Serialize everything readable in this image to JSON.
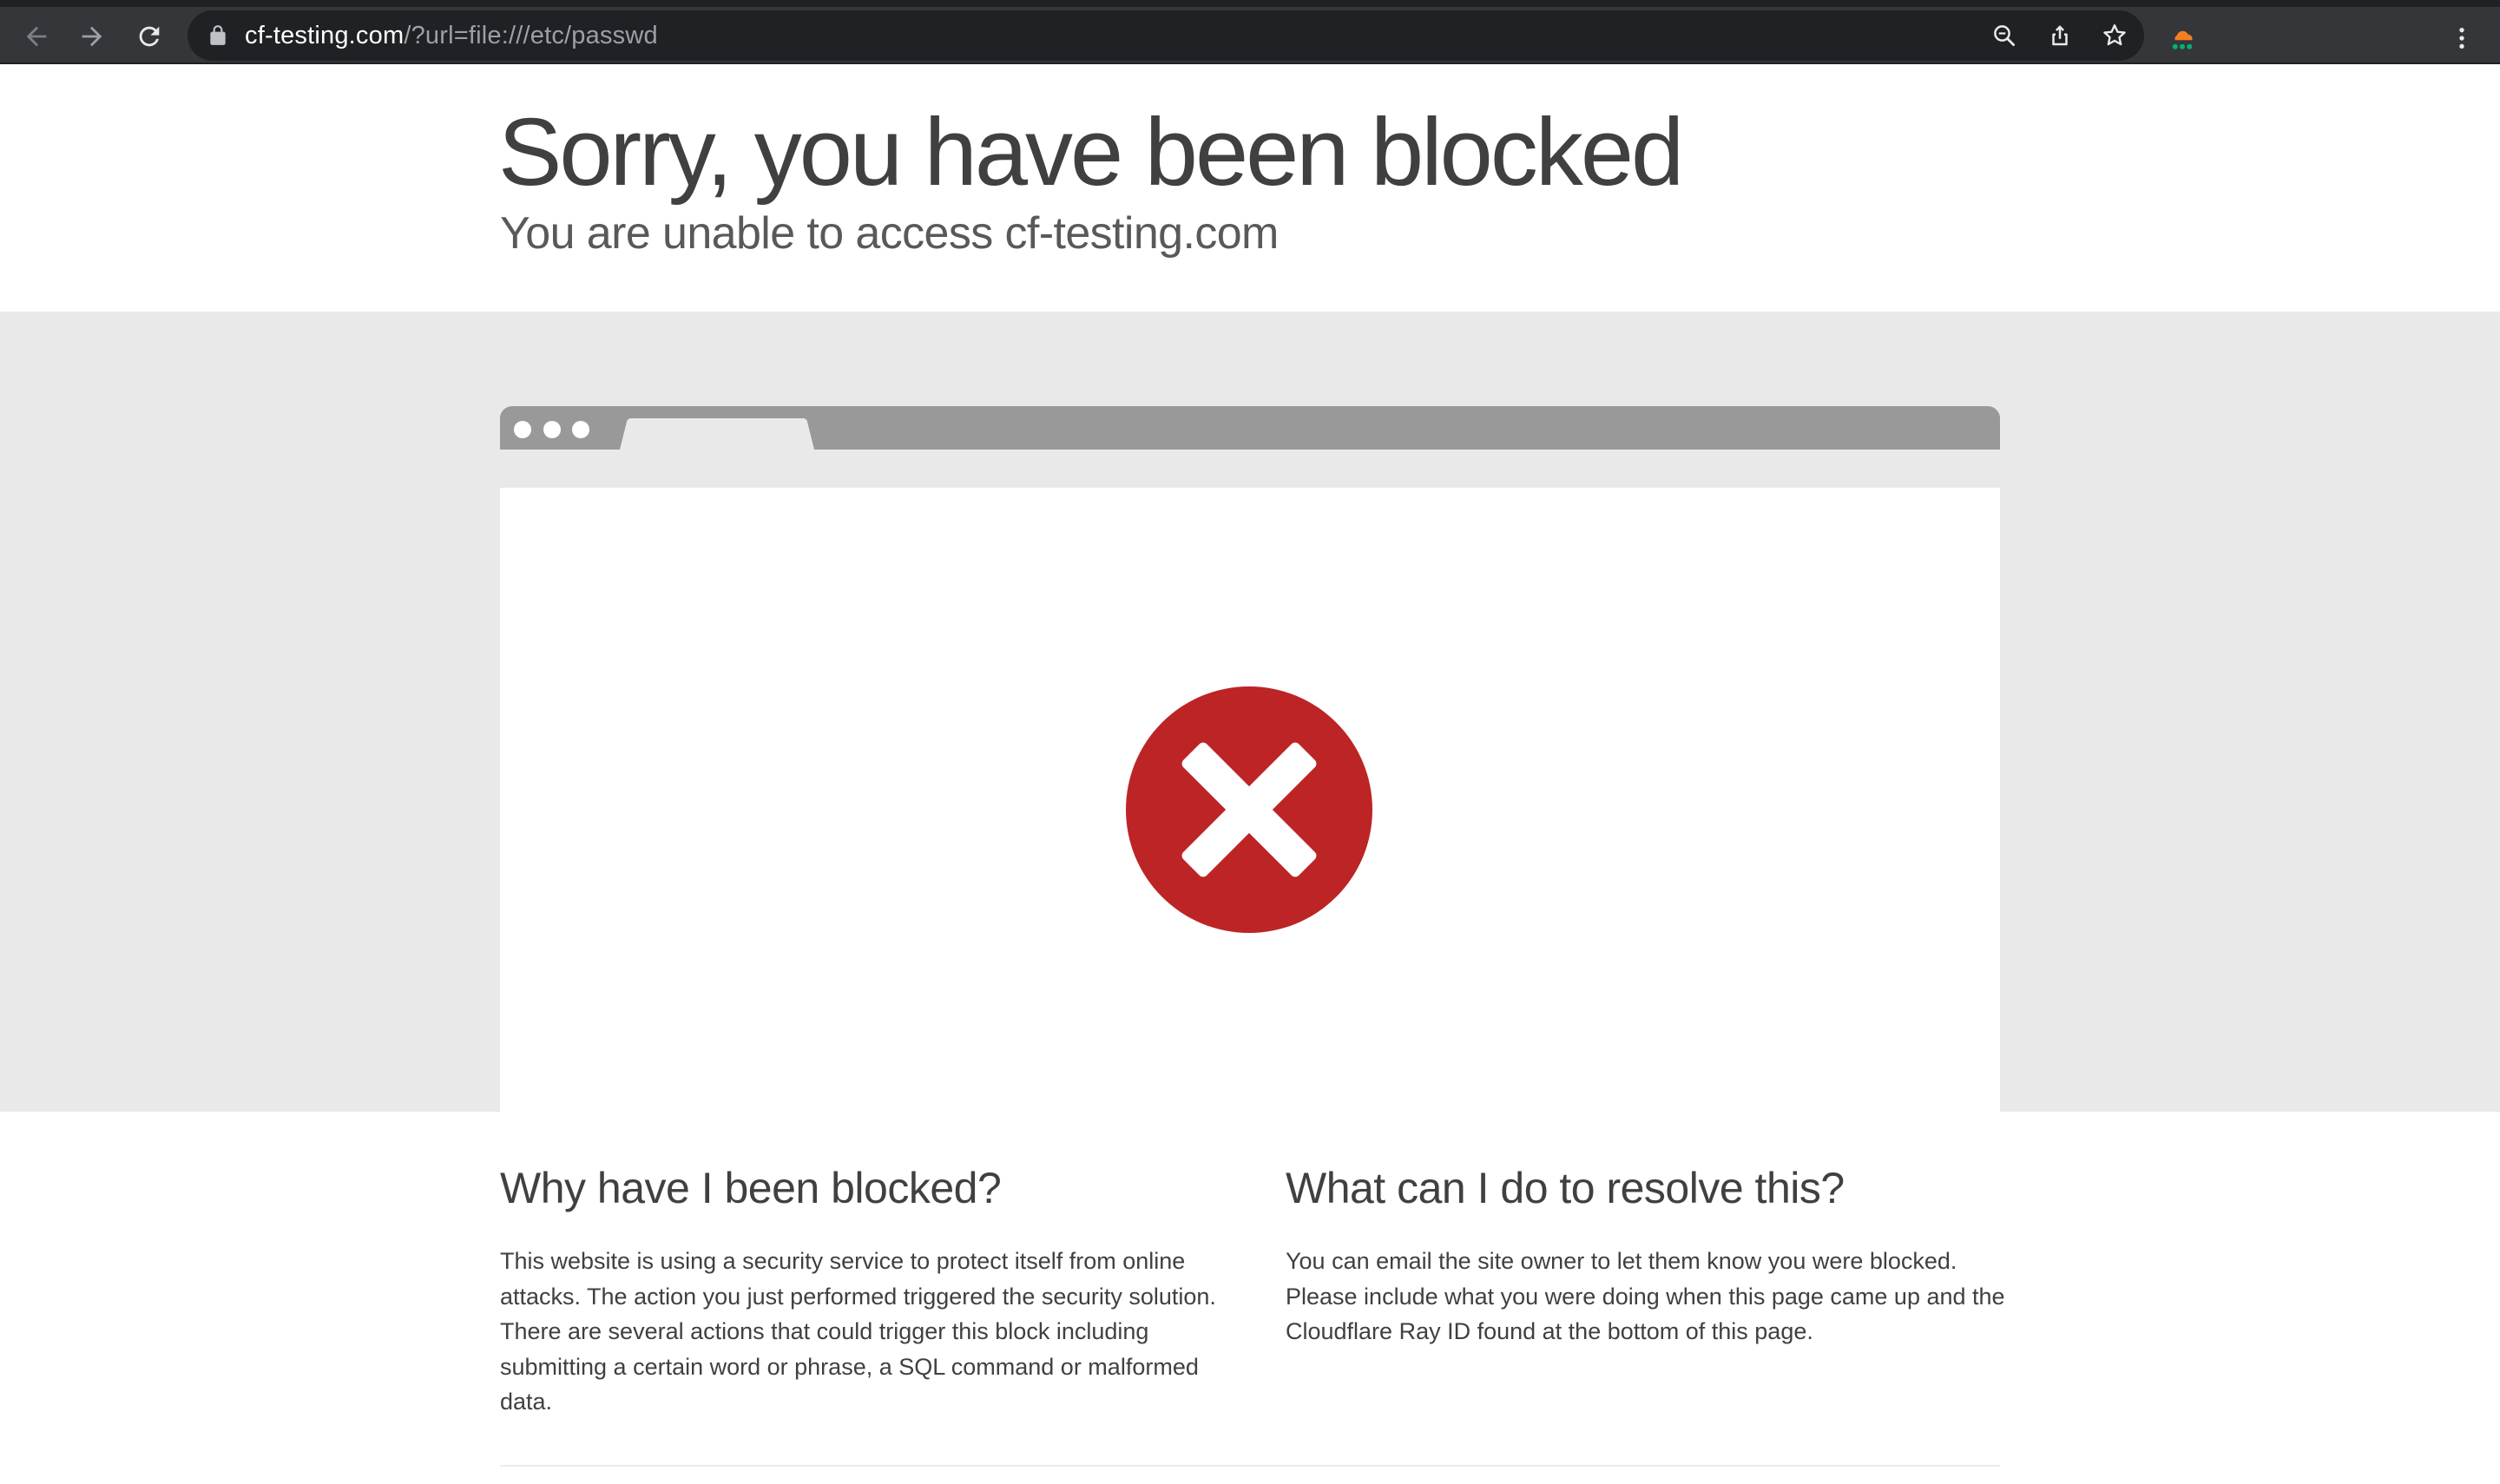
{
  "browser": {
    "url_host": "cf-testing.com",
    "url_path": "/?url=file:///etc/passwd",
    "toolbar_icons": [
      "back-arrow-icon",
      "forward-arrow-icon",
      "reload-icon",
      "lock-icon",
      "zoom-icon",
      "share-icon",
      "bookmark-star-icon",
      "cloudflare-extension-icon",
      "kebab-menu-icon"
    ],
    "extension_colors": {
      "cloud": "#f38020",
      "dots": "#00b26f"
    }
  },
  "page": {
    "title": "Sorry, you have been blocked",
    "subtitle": "You are unable to access cf-testing.com",
    "error_icon_color": "#bd2426",
    "sections": [
      {
        "heading": "Why have I been blocked?",
        "body": "This website is using a security service to protect itself from online attacks. The action you just performed triggered the security solution. There are several actions that could trigger this block including submitting a certain word or phrase, a SQL command or malformed data."
      },
      {
        "heading": "What can I do to resolve this?",
        "body": "You can email the site owner to let them know you were blocked. Please include what you were doing when this page came up and the Cloudflare Ray ID found at the bottom of this page."
      }
    ]
  }
}
